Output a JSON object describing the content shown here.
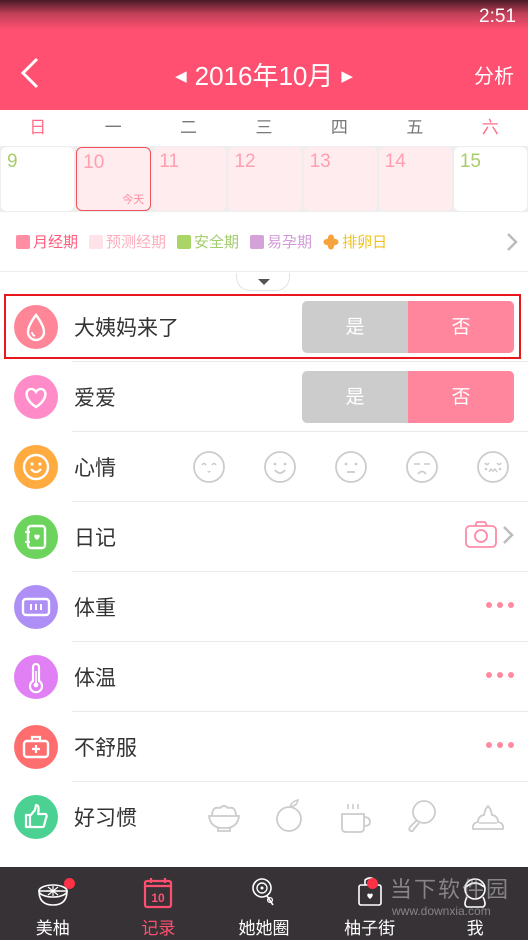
{
  "status_bar": {
    "time": "2:51"
  },
  "header": {
    "title": "2016年10月",
    "prev_month_glyph": "◀",
    "next_month_glyph": "▶",
    "analyze_label": "分析",
    "back_icon": "chevron-left-icon"
  },
  "calendar": {
    "weekdays": [
      "日",
      "一",
      "二",
      "三",
      "四",
      "五",
      "六"
    ],
    "days": [
      {
        "num": "9",
        "type": "safe"
      },
      {
        "num": "10",
        "type": "today",
        "today_label": "今天"
      },
      {
        "num": "11",
        "type": "period"
      },
      {
        "num": "12",
        "type": "period"
      },
      {
        "num": "13",
        "type": "period"
      },
      {
        "num": "14",
        "type": "period"
      },
      {
        "num": "15",
        "type": "safe"
      }
    ]
  },
  "legend": [
    {
      "label": "月经期",
      "color": "#ff8da3",
      "text_color": "#ff5c7c"
    },
    {
      "label": "预测经期",
      "color": "#ffe3e8",
      "text_color": "#ffadbc"
    },
    {
      "label": "安全期",
      "color": "#a9d466",
      "text_color": "#a3cc6c"
    },
    {
      "label": "易孕期",
      "color": "#d4a2d8",
      "text_color": "#d49ad8"
    },
    {
      "label": "排卵日",
      "color": "#f6a33d",
      "text_color": "#f0c21c"
    }
  ],
  "rows": {
    "period": {
      "label": "大姨妈来了",
      "yes": "是",
      "no": "否",
      "icon_color": "#ff8697",
      "selected": "否"
    },
    "love": {
      "label": "爱爱",
      "yes": "是",
      "no": "否",
      "icon_color": "#ff8cc8",
      "selected": "否"
    },
    "mood": {
      "label": "心情",
      "icon_color": "#ffab40",
      "options": [
        "happy",
        "smile",
        "neutral",
        "unhappy",
        "crying"
      ]
    },
    "diary": {
      "label": "日记",
      "icon_color": "#6cd45d"
    },
    "weight": {
      "label": "体重",
      "icon_color": "#ae8ff5"
    },
    "temperature": {
      "label": "体温",
      "icon_color": "#e17ff4"
    },
    "discomfort": {
      "label": "不舒服",
      "icon_color": "#ff6e6e"
    },
    "habits": {
      "label": "好习惯",
      "icon_color": "#4bd192",
      "options": [
        "breakfast-bowl",
        "fruit",
        "drink-water",
        "exercise",
        "bowel"
      ]
    }
  },
  "tabbar": {
    "tabs": [
      {
        "label": "美柚",
        "badge": true
      },
      {
        "label": "记录",
        "active": true,
        "calendar_num": "10"
      },
      {
        "label": "她她圈"
      },
      {
        "label": "柚子街",
        "badge": true
      },
      {
        "label": "我"
      }
    ],
    "accent": "#ff5071"
  },
  "watermark": {
    "line1": "当下软件园",
    "line2": "www.downxia.com"
  }
}
